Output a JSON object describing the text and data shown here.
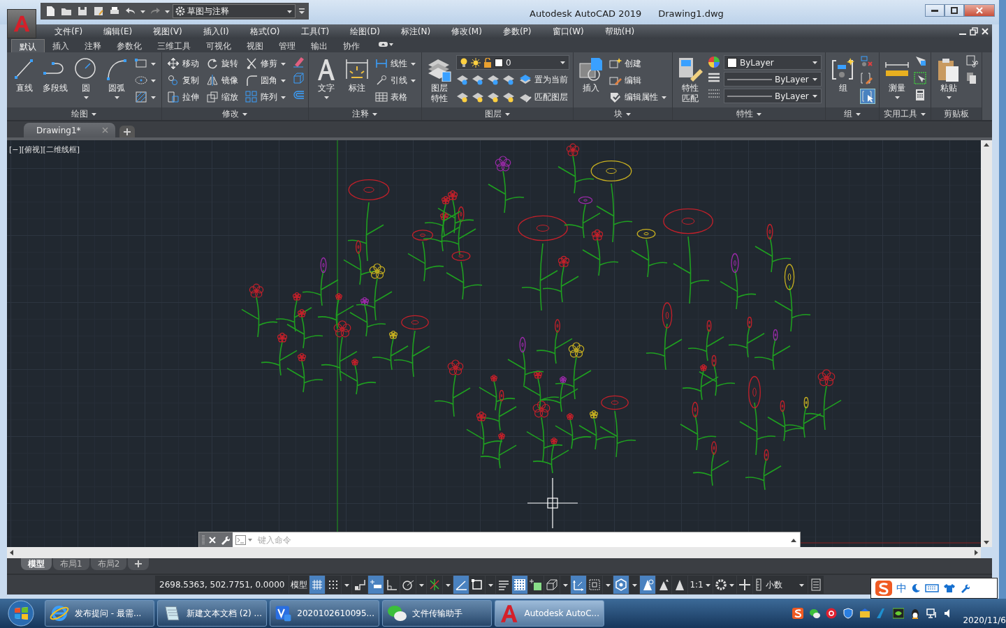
{
  "title_bar": {
    "workspace": "草图与注释",
    "app_title": "Autodesk AutoCAD 2019",
    "file_name": "Drawing1.dwg"
  },
  "menu_bar": [
    "文件(F)",
    "编辑(E)",
    "视图(V)",
    "插入(I)",
    "格式(O)",
    "工具(T)",
    "绘图(D)",
    "标注(N)",
    "修改(M)",
    "参数(P)",
    "窗口(W)",
    "帮助(H)"
  ],
  "ribbon_tabs": [
    {
      "label": "默认",
      "selected": true
    },
    {
      "label": "插入",
      "selected": false
    },
    {
      "label": "注释",
      "selected": false
    },
    {
      "label": "参数化",
      "selected": false
    },
    {
      "label": "三维工具",
      "selected": false
    },
    {
      "label": "可视化",
      "selected": false
    },
    {
      "label": "视图",
      "selected": false
    },
    {
      "label": "管理",
      "selected": false
    },
    {
      "label": "输出",
      "selected": false
    },
    {
      "label": "协作",
      "selected": false
    }
  ],
  "ribbon_panels": [
    {
      "kind": "draw",
      "title": "绘图",
      "large": [
        "直线",
        "多段线",
        "圆",
        "圆弧"
      ]
    },
    {
      "kind": "modify",
      "title": "修改",
      "small": [
        "移动",
        "旋转",
        "修剪",
        "复制",
        "镜像",
        "圆角",
        "拉伸",
        "缩放",
        "阵列"
      ]
    },
    {
      "kind": "annotate",
      "title": "注释",
      "large": [
        "文字",
        "标注"
      ],
      "small": [
        "线性",
        "引线",
        "表格"
      ]
    },
    {
      "kind": "layers",
      "title": "图层",
      "large": [
        "图层特性"
      ],
      "layer": "0",
      "small": [
        "置为当前",
        "匹配图层"
      ]
    },
    {
      "kind": "block",
      "title": "块",
      "large": [
        "插入"
      ],
      "small": [
        "创建",
        "编辑",
        "编辑属性"
      ]
    },
    {
      "kind": "properties",
      "title": "特性",
      "large": [
        "特性匹配"
      ],
      "combos": [
        "ByLayer",
        "ByLayer",
        "ByLayer"
      ]
    },
    {
      "kind": "group",
      "title": "组",
      "large": [
        "组"
      ]
    },
    {
      "kind": "utilities",
      "title": "实用工具",
      "large": [
        "测量"
      ]
    },
    {
      "kind": "clipboard",
      "title": "剪贴板",
      "large": [
        "粘贴"
      ]
    }
  ],
  "file_tabs": [
    {
      "label": "Drawing1*",
      "selected": true
    }
  ],
  "viewport_label": "[−][俯视][二维线框]",
  "command_line": {
    "placeholder": "键入命令"
  },
  "layout_tabs": [
    {
      "label": "模型",
      "selected": true
    },
    {
      "label": "布局1",
      "selected": false
    },
    {
      "label": "布局2",
      "selected": false
    }
  ],
  "status_bar": {
    "coordinates": "2698.5363, 502.7751, 0.0000",
    "space": "模型",
    "toggles": [
      {
        "kind": "grid",
        "on": true
      },
      {
        "kind": "snap",
        "on": false
      },
      {
        "kind": "infer",
        "on": false
      },
      {
        "kind": "snapmode",
        "on": true
      },
      {
        "kind": "ortho",
        "on": false
      },
      {
        "kind": "polar",
        "on": false
      },
      {
        "kind": "track",
        "on": false
      },
      {
        "kind": "osnap",
        "on": true
      },
      {
        "kind": "dynbox",
        "on": false
      },
      {
        "kind": "lineweight",
        "on": false
      },
      {
        "kind": "transparency",
        "on": true
      },
      {
        "kind": "cycling",
        "on": false
      },
      {
        "kind": "osnap3d",
        "on": false
      },
      {
        "kind": "ducs",
        "on": true
      },
      {
        "kind": "filter",
        "on": false
      },
      {
        "kind": "gizmo",
        "on": true
      },
      {
        "kind": "annovis",
        "on": true
      },
      {
        "kind": "autoscale",
        "on": false
      },
      {
        "kind": "annoscale",
        "on": false
      }
    ],
    "scale": "1:1",
    "units": "小数"
  },
  "ime_bar": {
    "mode": "中"
  },
  "taskbar": {
    "tasks": [
      {
        "label": "发布提问 - 最需...",
        "kind": "browser",
        "selected": false
      },
      {
        "label": "新建文本文档 (2) ...",
        "kind": "notepad",
        "selected": false
      },
      {
        "label": "2020102610095...",
        "kind": "doc",
        "selected": false
      },
      {
        "label": "文件传输助手",
        "kind": "chat",
        "selected": false
      },
      {
        "label": "Autodesk AutoC...",
        "kind": "cad",
        "selected": true
      }
    ],
    "date": "2020/11/6"
  }
}
